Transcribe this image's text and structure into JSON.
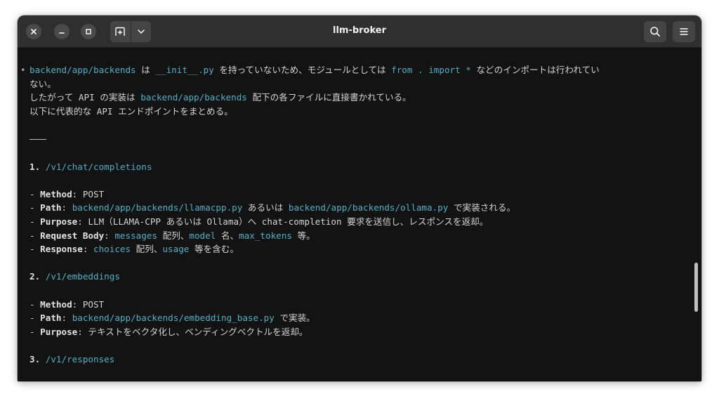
{
  "window": {
    "title": "llm-broker"
  },
  "icons": {
    "close": "close-icon",
    "minimize": "minimize-icon",
    "maximize": "maximize-icon",
    "new_tab": "new-tab-icon",
    "tab_menu": "chevron-down-icon",
    "search": "search-icon",
    "menu": "hamburger-menu-icon"
  },
  "colors": {
    "background": "#131313",
    "titlebar": "#2f2f2f",
    "accent_code": "#4db0c8",
    "text": "#d4d4d4"
  },
  "terminal": {
    "intro": {
      "bullet": "•",
      "p1": "backend/app/backends",
      "p2": " は ",
      "p3": "__init__.py",
      "p4": " を持っていないため、モジュールとしては ",
      "p5": "from . import *",
      "p6": " などのインポートは行われてい",
      "cont": "ない。"
    },
    "line3": {
      "a": "したがって API の実装は ",
      "b": "backend/app/backends",
      "c": " 配下の各ファイルに直接書かれている。"
    },
    "line4": "以下に代表的な API エンドポイントをまとめる。",
    "sections": [
      {
        "num": "1.",
        "endpoint": "/v1/chat/completions",
        "method_label": "Method",
        "method_value": "POST",
        "path_label": "Path",
        "path_a": "backend/app/backends/llamacpp.py",
        "path_b": " あるいは ",
        "path_c": "backend/app/backends/ollama.py",
        "path_d": " で実装される。",
        "purpose_label": "Purpose",
        "purpose_value": "LLM（LLAMA-CPP あるいは Ollama）へ chat-completion 要求を送信し、レスポンスを返却。",
        "request_label": "Request Body",
        "request_a": "messages",
        "request_b": " 配列、",
        "request_c": "model",
        "request_d": " 名、",
        "request_e": "max_tokens",
        "request_f": " 等。",
        "response_label": "Response",
        "response_a": "choices",
        "response_b": " 配列、",
        "response_c": "usage",
        "response_d": " 等を含む。"
      },
      {
        "num": "2.",
        "endpoint": "/v1/embeddings",
        "method_label": "Method",
        "method_value": "POST",
        "path_label": "Path",
        "path_a": "backend/app/backends/embedding_base.py",
        "path_b": " で実装。",
        "purpose_label": "Purpose",
        "purpose_value": "テキストをベクタ化し、ベンディングベクトルを返却。"
      },
      {
        "num": "3.",
        "endpoint": "/v1/responses"
      }
    ],
    "dash": "- ",
    "colon": ": "
  }
}
